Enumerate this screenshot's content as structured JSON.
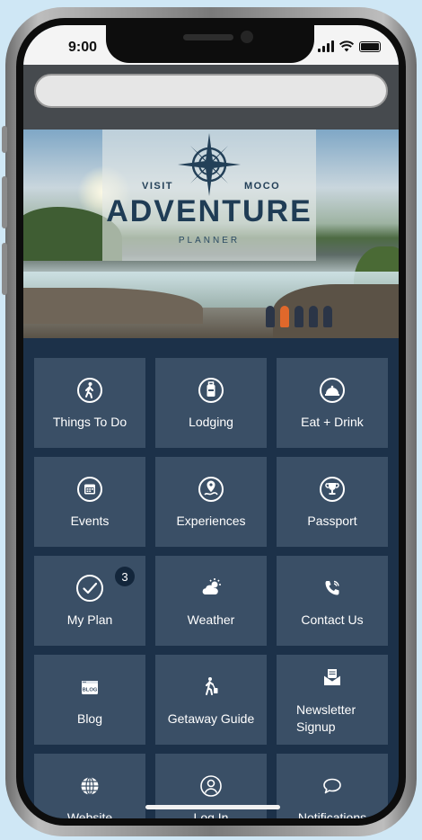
{
  "status_bar": {
    "time": "9:00"
  },
  "hero": {
    "visit": "VISIT",
    "moco": "MOCO",
    "title": "ADVENTURE",
    "subtitle": "PLANNER"
  },
  "tiles": [
    {
      "label": "Things To Do",
      "icon": "walking-person-icon"
    },
    {
      "label": "Lodging",
      "icon": "luggage-icon"
    },
    {
      "label": "Eat + Drink",
      "icon": "cloche-icon"
    },
    {
      "label": "Events",
      "icon": "calendar-icon"
    },
    {
      "label": "Experiences",
      "icon": "map-pin-icon"
    },
    {
      "label": "Passport",
      "icon": "trophy-icon"
    },
    {
      "label": "My Plan",
      "icon": "checkmark-icon",
      "badge": "3"
    },
    {
      "label": "Weather",
      "icon": "sun-cloud-icon"
    },
    {
      "label": "Contact Us",
      "icon": "phone-icon"
    },
    {
      "label": "Blog",
      "icon": "blog-icon"
    },
    {
      "label": "Getaway Guide",
      "icon": "traveler-icon"
    },
    {
      "label": "Newsletter Signup",
      "icon": "envelope-icon"
    },
    {
      "label": "Website",
      "icon": "globe-icon"
    },
    {
      "label": "Log In",
      "icon": "user-icon"
    },
    {
      "label": "Notifications",
      "icon": "chat-bubble-icon"
    }
  ]
}
